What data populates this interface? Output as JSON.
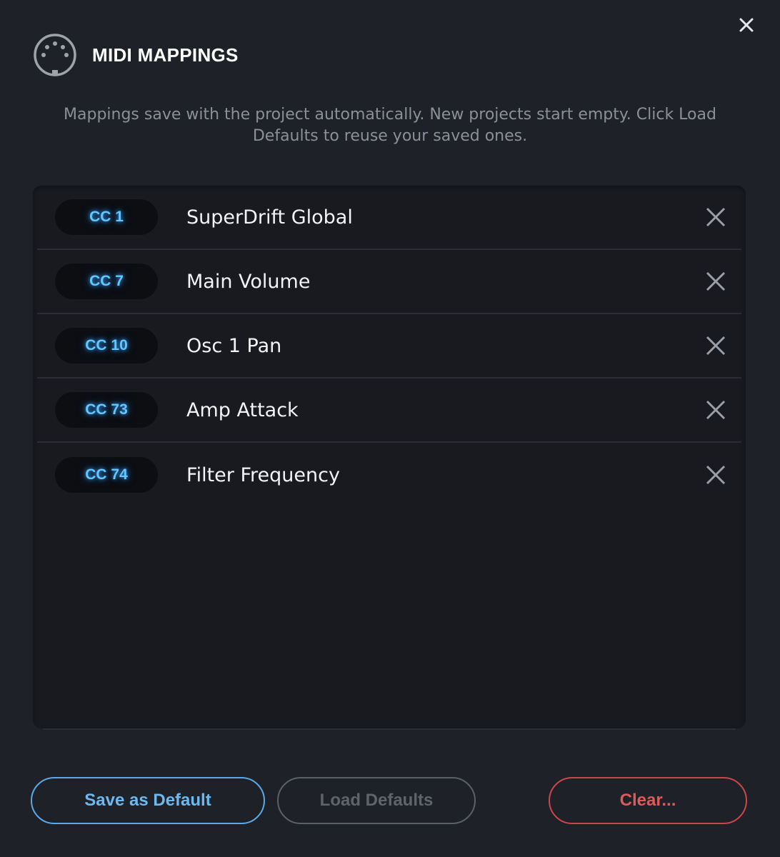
{
  "dialog": {
    "title": "MIDI MAPPINGS",
    "subtitle": "Mappings save with the project automatically. New projects start empty. Click Load Defaults to reuse your saved ones.",
    "close_icon": "close-icon",
    "header_icon": "midi-connector-icon"
  },
  "mappings": [
    {
      "cc": "CC 1",
      "name": "SuperDrift Global"
    },
    {
      "cc": "CC 7",
      "name": "Main Volume"
    },
    {
      "cc": "CC 10",
      "name": "Osc 1 Pan"
    },
    {
      "cc": "CC 73",
      "name": "Amp Attack"
    },
    {
      "cc": "CC 74",
      "name": "Filter Frequency"
    }
  ],
  "buttons": {
    "save_default": "Save as Default",
    "load_defaults": "Load Defaults",
    "clear": "Clear..."
  },
  "colors": {
    "background": "#1f2128",
    "list_background": "#181a1f",
    "cc_text": "#63c6ff",
    "save_accent": "#5aa9e6",
    "load_disabled": "#5b5f68",
    "clear_accent": "#c9474a"
  }
}
